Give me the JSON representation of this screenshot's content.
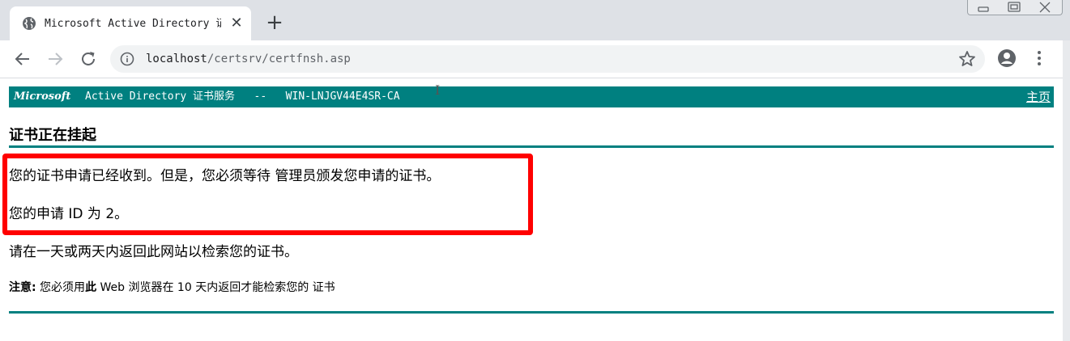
{
  "browser": {
    "tab_title": "Microsoft Active Directory 证书服务",
    "tab_close": "✕",
    "new_tab": "+",
    "url_host": "localhost",
    "url_path": "/certsrv/certfnsh.asp",
    "icons": [
      "globe-icon",
      "back-icon",
      "forward-icon",
      "reload-icon",
      "info-icon",
      "star-icon",
      "profile-icon",
      "menu-icon",
      "minimize-icon",
      "restore-icon",
      "close-icon"
    ]
  },
  "header": {
    "brand": "Microsoft",
    "service": "Active Directory 证书服务   --   WIN-LNJGV44E4SR-CA",
    "home_link": "主页",
    "color": "#008080"
  },
  "main": {
    "heading": "证书正在挂起",
    "received_message": "您的证书申请已经收到。但是，您必须等待 管理员颁发您申请的证书。",
    "request_id_message": "您的申请 ID 为 2。",
    "return_message": "请在一天或两天内返回此网站以检索您的证书。",
    "note_label": "注意:",
    "note_pre": " 您必须用",
    "note_bold": "此",
    "note_post": " Web 浏览器在 10 天内返回才能检索您的 证书",
    "highlight_color": "#ff0000"
  }
}
